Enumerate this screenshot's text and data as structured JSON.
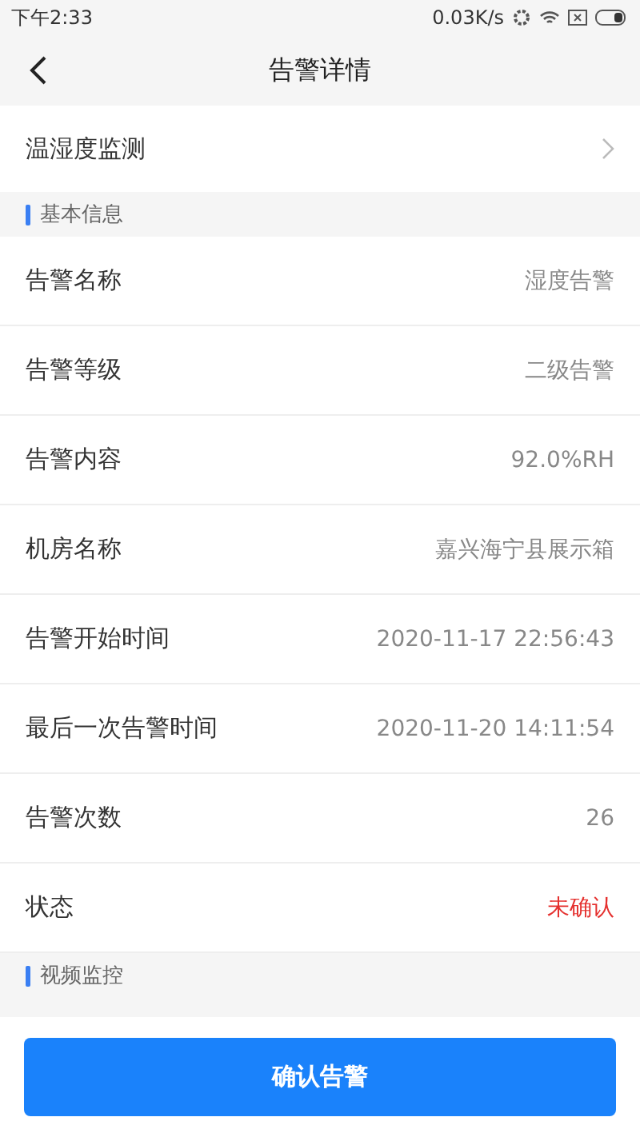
{
  "status_bar": {
    "time": "下午2:33",
    "speed": "0.03K/s"
  },
  "header": {
    "title": "告警详情"
  },
  "source": {
    "label": "温湿度监测"
  },
  "sections": [
    {
      "title": "基本信息",
      "rows": [
        {
          "label": "告警名称",
          "value": "湿度告警",
          "kind": "normal"
        },
        {
          "label": "告警等级",
          "value": "二级告警",
          "kind": "normal"
        },
        {
          "label": "告警内容",
          "value": "92.0%RH",
          "kind": "normal"
        },
        {
          "label": "机房名称",
          "value": "嘉兴海宁县展示箱",
          "kind": "normal"
        },
        {
          "label": "告警开始时间",
          "value": "2020-11-17 22:56:43",
          "kind": "normal"
        },
        {
          "label": "最后一次告警时间",
          "value": "2020-11-20 14:11:54",
          "kind": "normal"
        },
        {
          "label": "告警次数",
          "value": "26",
          "kind": "normal"
        },
        {
          "label": "状态",
          "value": "未确认",
          "kind": "alert"
        }
      ]
    },
    {
      "title": "视频监控"
    }
  ],
  "confirm_button": "确认告警"
}
